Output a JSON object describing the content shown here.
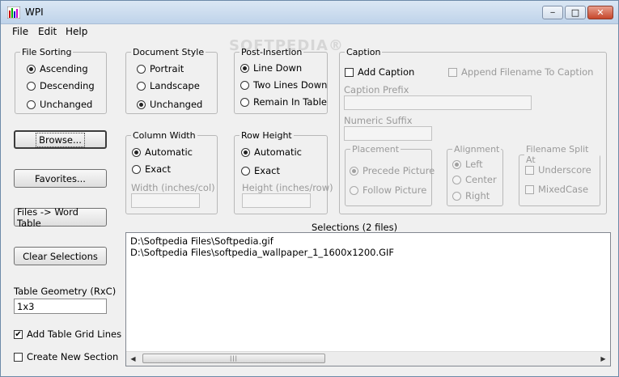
{
  "window": {
    "title": "WPI",
    "minimize": "‒",
    "maximize": "□",
    "close": "✕"
  },
  "menu": [
    "File",
    "Edit",
    "Help"
  ],
  "watermark": "SOFTPEDIA®",
  "file_sorting": {
    "legend": "File Sorting",
    "options": [
      "Ascending",
      "Descending",
      "Unchanged"
    ],
    "selected": "Ascending"
  },
  "document_style": {
    "legend": "Document Style",
    "options": [
      "Portrait",
      "Landscape",
      "Unchanged"
    ],
    "selected": "Unchanged"
  },
  "post_insertion": {
    "legend": "Post-Insertion",
    "options": [
      "Line Down",
      "Two Lines Down",
      "Remain In Table"
    ],
    "selected": "Line Down"
  },
  "caption": {
    "legend": "Caption",
    "add_caption": "Add Caption",
    "append_filename": "Append Filename To Caption",
    "prefix_label": "Caption Prefix",
    "prefix_value": "",
    "numeric_suffix_label": "Numeric Suffix",
    "numeric_suffix_value": "",
    "placement": {
      "legend": "Placement",
      "options": [
        "Precede Picture",
        "Follow Picture"
      ],
      "selected": "Precede Picture"
    },
    "alignment": {
      "legend": "Alignment",
      "options": [
        "Left",
        "Center",
        "Right"
      ],
      "selected": "Left"
    },
    "filename_split": {
      "legend": "Filename Split At",
      "options": [
        "Underscore",
        "MixedCase"
      ]
    }
  },
  "column_width": {
    "legend": "Column Width",
    "options": [
      "Automatic",
      "Exact"
    ],
    "selected": "Automatic",
    "field_label": "Width (inches/col)",
    "field_value": ""
  },
  "row_height": {
    "legend": "Row Height",
    "options": [
      "Automatic",
      "Exact"
    ],
    "selected": "Automatic",
    "field_label": "Height (inches/row)",
    "field_value": ""
  },
  "buttons": {
    "browse": "Browse...",
    "favorites": "Favorites...",
    "files_to_word": "Files -> Word Table",
    "clear": "Clear Selections"
  },
  "table_geometry": {
    "label": "Table Geometry (RxC)",
    "value": "1x3"
  },
  "add_grid_lines": {
    "label": "Add Table Grid Lines",
    "checked": true
  },
  "create_section": {
    "label": "Create New Section",
    "checked": false
  },
  "selections": {
    "label": "Selections (2 files)",
    "items": [
      "D:\\Softpedia Files\\Softpedia.gif",
      "D:\\Softpedia Files\\softpedia_wallpaper_1_1600x1200.GIF"
    ]
  },
  "icons": {
    "left_arrow": "◀",
    "right_arrow": "▶",
    "grip": "|||",
    "check": "✔"
  }
}
